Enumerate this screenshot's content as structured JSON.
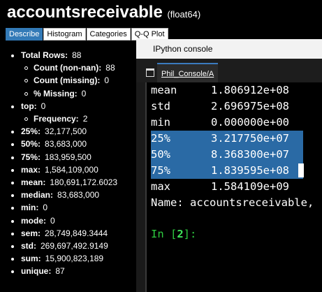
{
  "header": {
    "title": "accountsreceivable",
    "dtype": "(float64)"
  },
  "tabs": [
    {
      "label": "Describe",
      "active": true
    },
    {
      "label": "Histogram",
      "active": false
    },
    {
      "label": "Categories",
      "active": false
    },
    {
      "label": "Q-Q Plot",
      "active": false
    }
  ],
  "stats": [
    {
      "label": "Total Rows:",
      "value": "88",
      "sub": false
    },
    {
      "label": "Count (non-nan):",
      "value": "88",
      "sub": true
    },
    {
      "label": "Count (missing):",
      "value": "0",
      "sub": true
    },
    {
      "label": "% Missing:",
      "value": "0",
      "sub": true
    },
    {
      "label": "top:",
      "value": "0",
      "sub": false
    },
    {
      "label": "Frequency:",
      "value": "2",
      "sub": true
    },
    {
      "label": "25%:",
      "value": "32,177,500",
      "sub": false
    },
    {
      "label": "50%:",
      "value": "83,683,000",
      "sub": false
    },
    {
      "label": "75%:",
      "value": "183,959,500",
      "sub": false
    },
    {
      "label": "max:",
      "value": "1,584,109,000",
      "sub": false
    },
    {
      "label": "mean:",
      "value": "180,691,172.6023",
      "sub": false
    },
    {
      "label": "median:",
      "value": "83,683,000",
      "sub": false
    },
    {
      "label": "min:",
      "value": "0",
      "sub": false
    },
    {
      "label": "mode:",
      "value": "0",
      "sub": false
    },
    {
      "label": "sem:",
      "value": "28,749,849.3444",
      "sub": false
    },
    {
      "label": "std:",
      "value": "269,697,492.9149",
      "sub": false
    },
    {
      "label": "sum:",
      "value": "15,900,823,189",
      "sub": false
    },
    {
      "label": "unique:",
      "value": "87",
      "sub": false
    }
  ],
  "console": {
    "window_title": "IPython console",
    "tab_label": "Phil_Console/A",
    "output_rows": [
      {
        "key": "mean",
        "value": "1.806912e+08",
        "selected": false
      },
      {
        "key": "std",
        "value": "2.696975e+08",
        "selected": false
      },
      {
        "key": "min",
        "value": "0.000000e+00",
        "selected": false
      },
      {
        "key": "25%",
        "value": "3.217750e+07",
        "selected": true
      },
      {
        "key": "50%",
        "value": "8.368300e+07",
        "selected": true
      },
      {
        "key": "75%",
        "value": "1.839595e+08",
        "selected": true
      },
      {
        "key": "max",
        "value": "1.584109e+09",
        "selected": false
      }
    ],
    "name_line": "Name: accountsreceivable,",
    "prompt_prefix": "In [",
    "prompt_number": "2",
    "prompt_suffix": "]:"
  },
  "colors": {
    "tab_active": "#337ab7",
    "selection": "#2a6aa5",
    "prompt": "#2ecc40"
  }
}
